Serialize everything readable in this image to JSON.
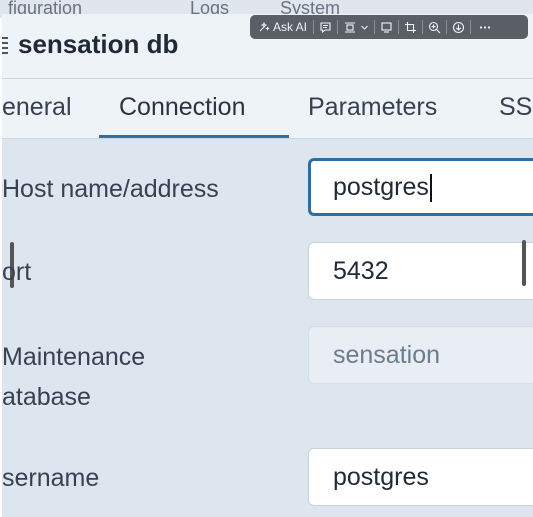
{
  "background_tabs": [
    "figuration",
    "Logs",
    "System"
  ],
  "dialog": {
    "title": "sensation db",
    "toolbar": {
      "ask_ai_label": "Ask AI",
      "buttons": [
        "ask-ai",
        "comment",
        "frame-dropdown",
        "tablet",
        "crop",
        "zoom-in",
        "download",
        "more"
      ]
    },
    "tabs": [
      {
        "label": "eneral",
        "active": false
      },
      {
        "label": "Connection",
        "active": true
      },
      {
        "label": "Parameters",
        "active": false
      },
      {
        "label": "SS",
        "active": false
      }
    ],
    "fields": {
      "host": {
        "label": "Host name/address",
        "value": "postgres"
      },
      "port": {
        "label": "ort",
        "value": "5432"
      },
      "maintenance": {
        "label_line1": "Maintenance",
        "label_line2": "atabase",
        "value": "sensation"
      },
      "username": {
        "label": "sername",
        "value": "postgres"
      }
    }
  },
  "colors": {
    "accent": "#2f6e9e",
    "panel_bg": "#dde6ef",
    "toolbar_bg": "#5a5e66"
  }
}
